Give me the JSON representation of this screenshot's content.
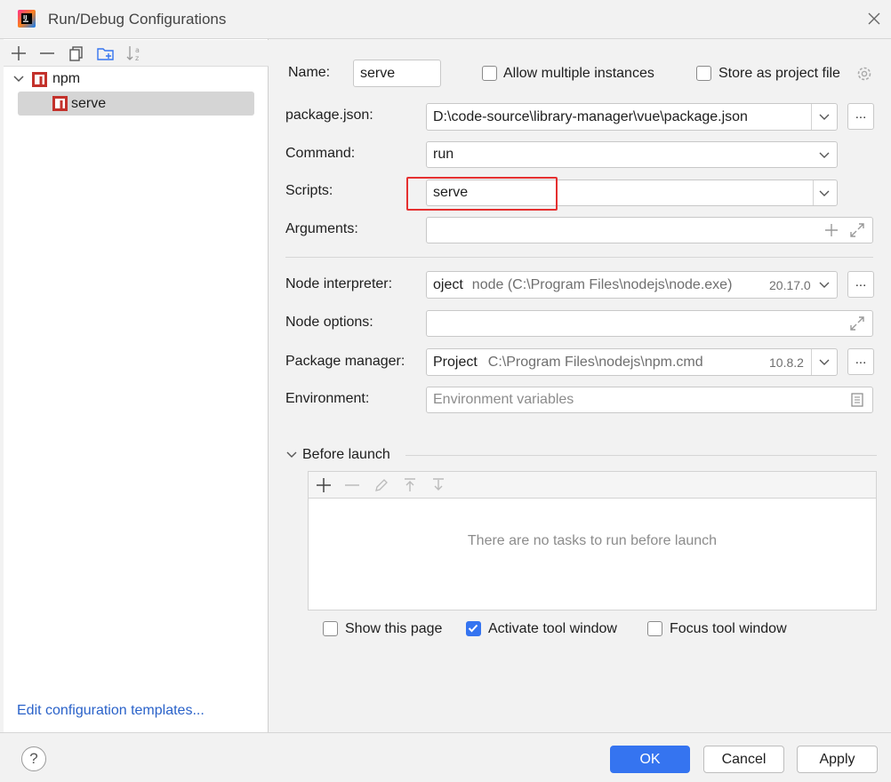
{
  "window": {
    "title": "Run/Debug Configurations"
  },
  "sidebar": {
    "tree": {
      "group_label": "npm",
      "item_label": "serve"
    },
    "templates_link": "Edit configuration templates..."
  },
  "form": {
    "name_label": "Name:",
    "name_value": "serve",
    "allow_multiple_label": "Allow multiple instances",
    "allow_multiple_checked": false,
    "store_project_file_label": "Store as project file",
    "store_project_file_checked": false,
    "package_json_label": "package.json:",
    "package_json_value": "D:\\code-source\\library-manager\\vue\\package.json",
    "command_label": "Command:",
    "command_value": "run",
    "scripts_label": "Scripts:",
    "scripts_value": "serve",
    "arguments_label": "Arguments:",
    "arguments_value": "",
    "node_interpreter_label": "Node interpreter:",
    "node_interpreter_prefix": "oject",
    "node_interpreter_path": "node (C:\\Program Files\\nodejs\\node.exe)",
    "node_interpreter_version": "20.17.0",
    "node_options_label": "Node options:",
    "node_options_value": "",
    "package_manager_label": "Package manager:",
    "package_manager_prefix": "Project",
    "package_manager_path": "C:\\Program Files\\nodejs\\npm.cmd",
    "package_manager_version": "10.8.2",
    "environment_label": "Environment:",
    "environment_placeholder": "Environment variables",
    "browse_label": "..."
  },
  "before_launch": {
    "title": "Before launch",
    "empty_text": "There are no tasks to run before launch"
  },
  "options": {
    "show_page_label": "Show this page",
    "show_page_checked": false,
    "activate_tool_label": "Activate tool window",
    "activate_tool_checked": true,
    "focus_tool_label": "Focus tool window",
    "focus_tool_checked": false
  },
  "footer": {
    "help_label": "?",
    "ok_label": "OK",
    "cancel_label": "Cancel",
    "apply_label": "Apply"
  },
  "colors": {
    "accent": "#3574f0",
    "highlight": "#e53030",
    "link": "#2a62c9",
    "npm_icon": "#c3312b"
  }
}
